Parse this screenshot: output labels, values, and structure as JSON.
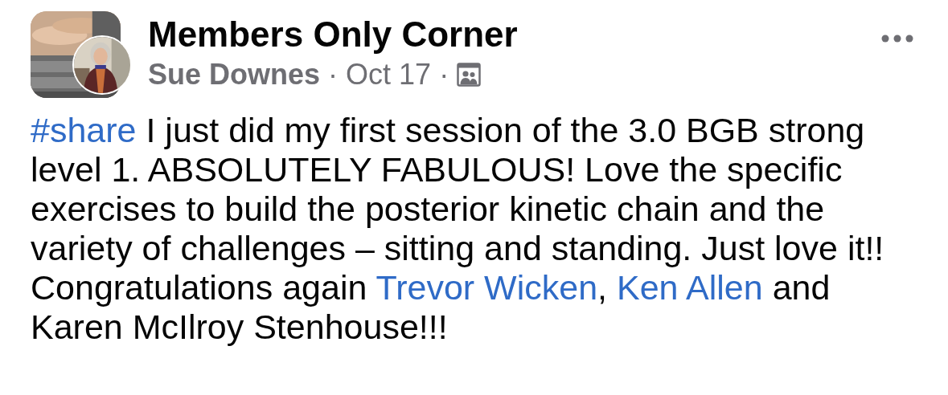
{
  "post": {
    "group_name": "Members Only Corner",
    "author": "Sue Downes",
    "separator_1": "·",
    "date": "Oct 17",
    "separator_2": "·",
    "body": [
      {
        "kind": "link",
        "text": "#share"
      },
      {
        "kind": "text",
        "text": " I just did my first session of the 3.0 BGB strong level 1. ABSOLUTELY FABULOUS! Love the specific exercises to build the posterior kinetic chain and the variety of challenges – sitting and standing. Just love it!! Congratulations again "
      },
      {
        "kind": "link",
        "text": "Trevor Wicken"
      },
      {
        "kind": "text",
        "text": ", "
      },
      {
        "kind": "link",
        "text": "Ken Allen"
      },
      {
        "kind": "text",
        "text": " and Karen McIlroy Stenhouse!!!"
      }
    ]
  }
}
